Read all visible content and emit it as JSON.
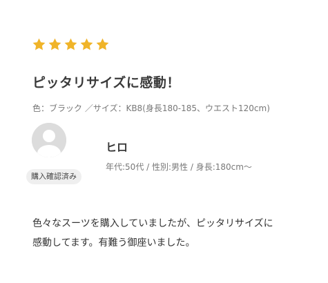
{
  "review": {
    "rating": 5,
    "rating_max": 5,
    "star_color": "#f0b429",
    "title": "ピッタリサイズに感動！",
    "attributes": "色：ブラック ／サイズ：KB8(身長180-185、ウエスト120cm)",
    "avatar_icon": "user-silhouette-icon",
    "verified_badge": "購入確認済み",
    "reviewer_name": "ヒロ",
    "reviewer_meta": "年代:50代 / 性別:男性 / 身長:180cm〜",
    "body_line1": "色々なスーツを購入していましたが、ピッタリサイズに",
    "body_line2": "感動してます。有難う御座いました。"
  }
}
